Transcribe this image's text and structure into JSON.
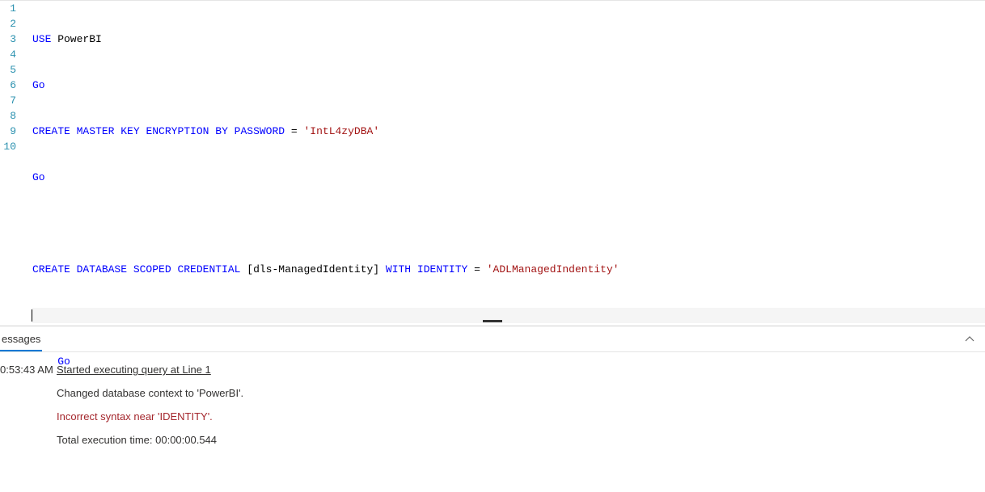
{
  "editor": {
    "lineNumbers": [
      "1",
      "2",
      "3",
      "4",
      "5",
      "6",
      "7",
      "8",
      "9",
      "10"
    ],
    "activeLine": 7,
    "lines": {
      "l1_kw": "USE",
      "l1_plain": " PowerBI",
      "l2_kw": "Go",
      "l3_kw1": "CREATE",
      "l3_kw2": " MASTER",
      "l3_kw3": " KEY",
      "l3_kw4": " ENCRYPTION",
      "l3_kw5": " BY",
      "l3_kw6": " PASSWORD",
      "l3_eq": " = ",
      "l3_str": "'IntL4zyDBA'",
      "l4_kw": "Go",
      "l6_kw1": "CREATE",
      "l6_kw2": " DATABASE",
      "l6_kw3": " SCOPED",
      "l6_kw4": " CREDENTIAL",
      "l6_plain1": " [dls-ManagedIdentity] ",
      "l6_kw5": "WITH",
      "l6_kw6": " IDENTITY",
      "l6_eq": " = ",
      "l6_str": "'ADLManagedIndentity'",
      "l8_indent": "    ",
      "l8_kw": "Go"
    }
  },
  "tabstrip": {
    "tab0": "essages"
  },
  "messages": {
    "time0": "0:53:43 AM",
    "startLine": "Started executing query at Line 1",
    "context": "Changed database context to 'PowerBI'.",
    "error": "Incorrect syntax near 'IDENTITY'.",
    "total": "Total execution time: 00:00:00.544"
  }
}
